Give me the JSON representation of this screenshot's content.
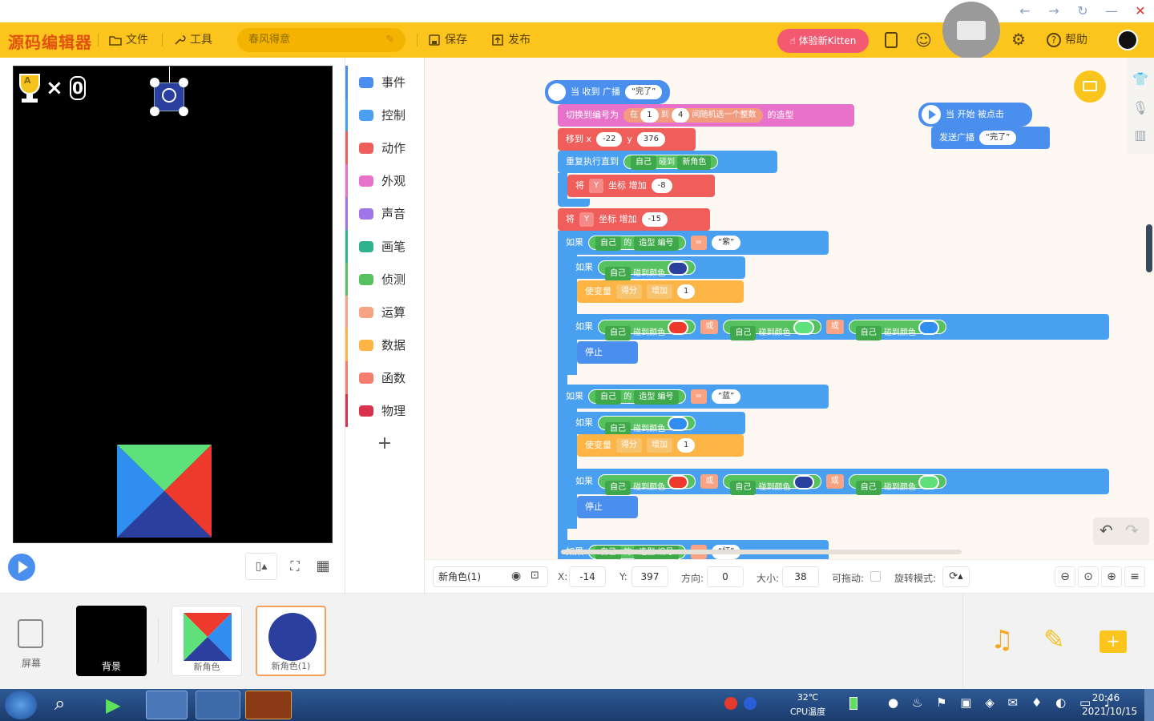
{
  "window": {
    "controls": [
      "←",
      "→",
      "↻",
      "—",
      "✕"
    ]
  },
  "toolbar": {
    "logo": "源码编辑器",
    "file": "文件",
    "tools": "工具",
    "project_name": "春风得意",
    "save": "保存",
    "publish": "发布",
    "kitten": "体验新Kitten",
    "help": "帮助"
  },
  "stage": {
    "score_symbol": "×",
    "score_value": "0",
    "trophy_letter": "A"
  },
  "categories": [
    {
      "label": "事件",
      "color": "#4a8fee"
    },
    {
      "label": "控制",
      "color": "#4aa0f0"
    },
    {
      "label": "动作",
      "color": "#ef5e5b"
    },
    {
      "label": "外观",
      "color": "#e872c9"
    },
    {
      "label": "声音",
      "color": "#a174e8"
    },
    {
      "label": "画笔",
      "color": "#2eb38c"
    },
    {
      "label": "侦测",
      "color": "#55c15f"
    },
    {
      "label": "运算",
      "color": "#f7a384"
    },
    {
      "label": "数据",
      "color": "#fcb445"
    },
    {
      "label": "函数",
      "color": "#f37e70"
    },
    {
      "label": "物理",
      "color": "#d9324c"
    }
  ],
  "add_category": "+",
  "blocks": {
    "recv": "当 收到 广播",
    "recv_msg": "“完了”",
    "switch": "切换到编号为",
    "in": "在",
    "n1": "1",
    "to": "到",
    "n4": "4",
    "rand": "间随机选一个整数",
    "costume": "的造型",
    "moveto": "移到 x",
    "x": "-22",
    "y_label": "y",
    "y": "376",
    "repeat_until": "重复执行直到",
    "self": "自己",
    "touch": "碰到",
    "newsprite": "新角色",
    "set": "将",
    "axis": "Y",
    "coord_add": "坐标 增加",
    "m8": "-8",
    "m15": "-15",
    "if": "如果",
    "of": "的",
    "costume_num": "造型 编号",
    "eq": "=",
    "purple": "“紫”",
    "blue": "“蓝”",
    "red": "“红”",
    "touch_color": "碰到颜色",
    "make_var": "使变量",
    "score": "得分",
    "inc": "增加",
    "one": "1",
    "or": "或",
    "stop": "停止",
    "start": "当 开始 被点击",
    "send": "发送广播",
    "send_msg": "“完了”"
  },
  "props": {
    "name": "新角色(1)",
    "x_label": "X:",
    "x": "-14",
    "y_label": "Y:",
    "y": "397",
    "dir_label": "方向:",
    "dir": "0",
    "size_label": "大小:",
    "size": "38",
    "drag_label": "可拖动:",
    "rot_label": "旋转模式:"
  },
  "sprites": {
    "screen": "屏幕",
    "bg": "背景",
    "s1": "新角色",
    "s2": "新角色(1)"
  },
  "taskbar": {
    "temp": "32℃",
    "temp_label": "CPU温度",
    "time": "20:46",
    "date": "2021/10/15"
  },
  "colors": {
    "toolbar": "#fcc51e",
    "dark_blue": "#2b3f9e",
    "red": "#ee3a2c",
    "green": "#5ee07a",
    "light_blue": "#2f8ef0"
  }
}
